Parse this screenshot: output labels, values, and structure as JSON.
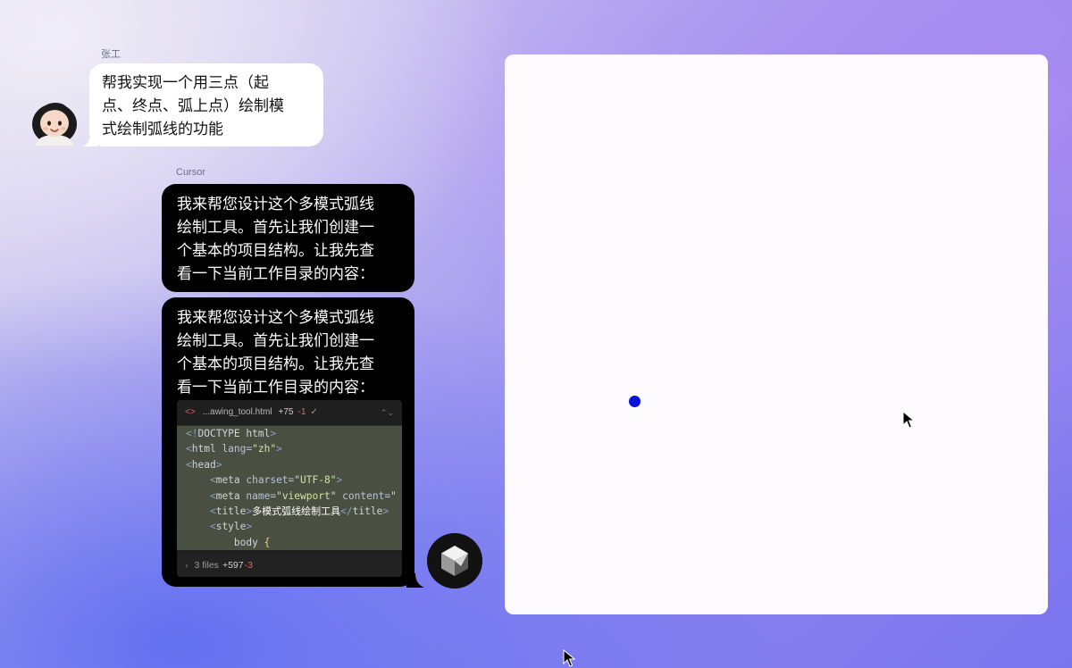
{
  "user": {
    "name": "张工",
    "message_lines": [
      "帮我实现一个用三点（起",
      "点、终点、弧上点）绘制模",
      "式绘制弧线的功能"
    ]
  },
  "assistant": {
    "name": "Cursor",
    "message_lines": [
      "我来帮您设计这个多模式弧线",
      "绘制工具。首先让我们创建一",
      "个基本的项目结构。让我先查",
      "看一下当前工作目录的内容："
    ]
  },
  "code_panel": {
    "filename": "...awing_tool.html",
    "additions": "+75",
    "deletions": "-1",
    "footer": {
      "files": "3 files",
      "additions": "+597",
      "deletions": "-3"
    }
  },
  "colors": {
    "canvas_point": "#0a14d8",
    "diff_added_bg": "#4a5041",
    "bubble_ai": "#000000",
    "bubble_user": "#ffffff"
  }
}
